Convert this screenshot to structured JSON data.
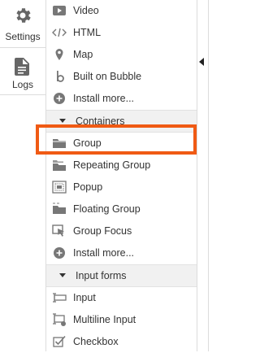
{
  "leftnav": {
    "settings_label": "Settings",
    "logs_label": "Logs"
  },
  "elements": {
    "visual": [
      {
        "label": "Video",
        "icon": "video-icon"
      },
      {
        "label": "HTML",
        "icon": "code-icon"
      },
      {
        "label": "Map",
        "icon": "map-pin-icon"
      },
      {
        "label": "Built on Bubble",
        "icon": "bubble-logo-icon"
      },
      {
        "label": "Install more...",
        "icon": "plus-circle-icon"
      }
    ],
    "containers_header": "Containers",
    "containers": [
      {
        "label": "Group",
        "icon": "folder-icon"
      },
      {
        "label": "Repeating Group",
        "icon": "folder-stack-icon"
      },
      {
        "label": "Popup",
        "icon": "popup-icon"
      },
      {
        "label": "Floating Group",
        "icon": "floating-folder-icon"
      },
      {
        "label": "Group Focus",
        "icon": "group-focus-icon"
      },
      {
        "label": "Install more...",
        "icon": "plus-circle-icon"
      }
    ],
    "inputs_header": "Input forms",
    "inputs": [
      {
        "label": "Input",
        "icon": "input-icon"
      },
      {
        "label": "Multiline Input",
        "icon": "multiline-input-icon"
      },
      {
        "label": "Checkbox",
        "icon": "checkbox-icon"
      }
    ]
  },
  "colors": {
    "highlight": "#f05a14",
    "section_bg": "#f1f1f1"
  }
}
